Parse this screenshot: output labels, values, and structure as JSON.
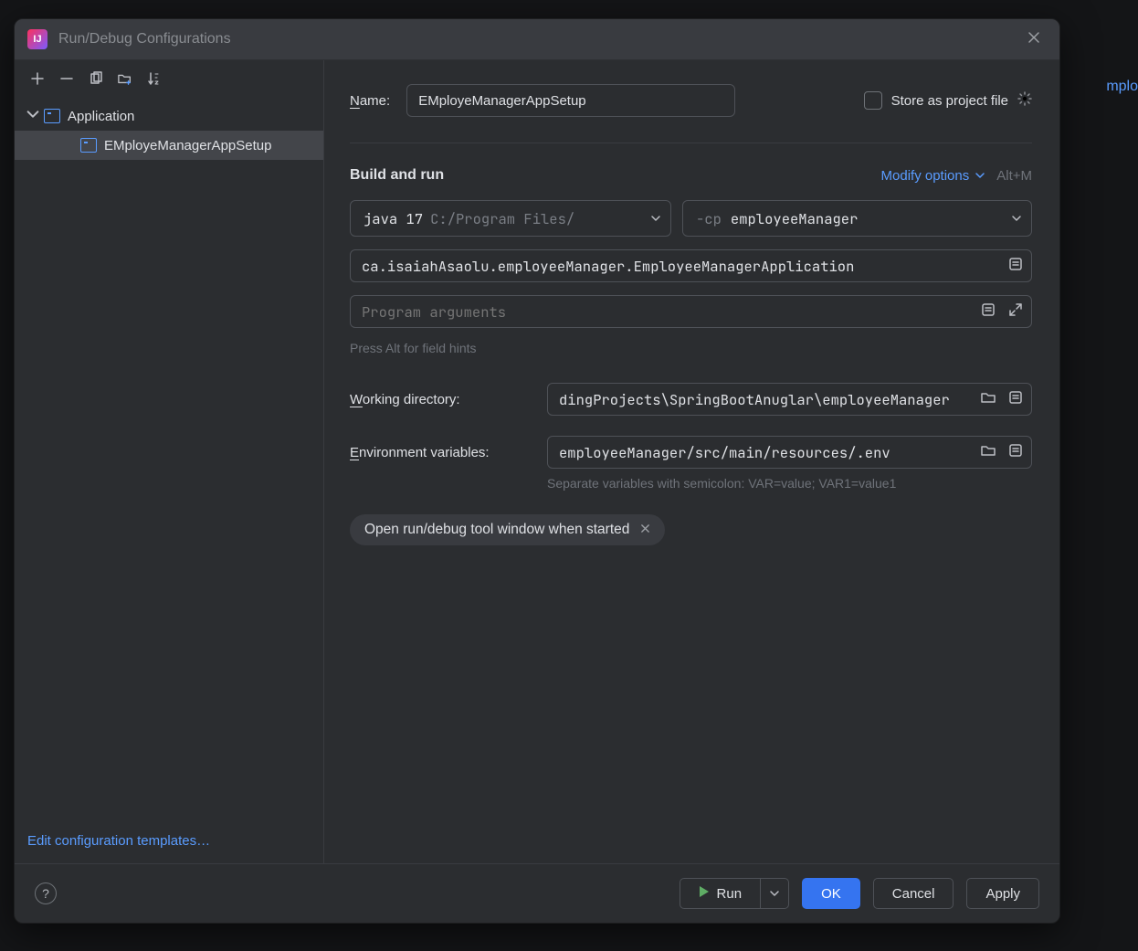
{
  "dialog": {
    "title": "Run/Debug Configurations"
  },
  "sidebar": {
    "group_label": "Application",
    "items": [
      {
        "label": "EMployeManagerAppSetup"
      }
    ],
    "edit_templates": "Edit configuration templates…"
  },
  "form": {
    "name_label_prefix": "N",
    "name_label_rest": "ame:",
    "name_value": "EMployeManagerAppSetup",
    "store_as_project": "Store as project file",
    "section_title": "Build and run",
    "modify_options": "Modify options",
    "modify_shortcut": "Alt+M",
    "jdk_main": "java 17",
    "jdk_dim": "C:/Program Files/",
    "cp_flag": "-cp",
    "cp_value": "employeeManager",
    "main_class": "ca.isaiahAsaolu.employeeManager.EmployeeManagerApplication",
    "program_args_placeholder": "Program arguments",
    "hint": "Press Alt for field hints",
    "wd_label_prefix": "W",
    "wd_label_rest": "orking directory:",
    "wd_value": "dingProjects\\SpringBootAnuglar\\employeeManager",
    "env_label_prefix": "E",
    "env_label_rest": "nvironment variables:",
    "env_value": "employeeManager/src/main/resources/.env",
    "env_hint": "Separate variables with semicolon: VAR=value; VAR1=value1",
    "chip_label": "Open run/debug tool window when started"
  },
  "footer": {
    "run": "Run",
    "ok": "OK",
    "cancel": "Cancel",
    "apply": "Apply"
  },
  "bg_hint": "mplo"
}
